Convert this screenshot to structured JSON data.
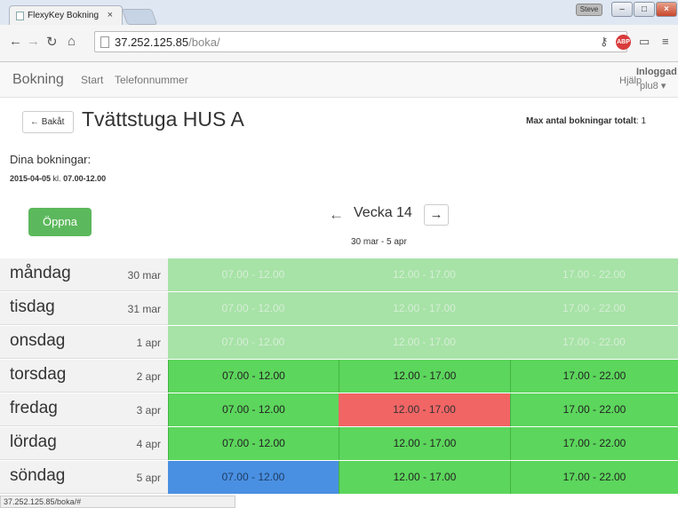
{
  "browser": {
    "tab_title": "FlexyKey Bokning",
    "tab_close": "×",
    "user_badge": "Steve",
    "url_host": "37.252.125.85",
    "url_path": "/boka/",
    "status_url": "37.252.125.85/boka/#"
  },
  "nav": {
    "brand": "Bokning",
    "links": [
      "Start",
      "Telefonnummer"
    ],
    "help": "Hjälp",
    "logged_in_label": "Inloggad:",
    "user": "plu8 ▾"
  },
  "header": {
    "back_label": "← Bakåt",
    "room_title": "Tvättstuga HUS A",
    "max_label": "Max antal bokningar totalt",
    "max_value": ": 1"
  },
  "my_bookings": {
    "label": "Dina bokningar:",
    "date": "2015-04-05",
    "kl": " kl. ",
    "time": "07.00-12.00"
  },
  "open_label": "Öppna",
  "week": {
    "prev": "←",
    "label": "Vecka 14",
    "next": "→",
    "range": "30 mar - 5 apr"
  },
  "schedule": [
    {
      "day": "måndag",
      "date": "30 mar",
      "slots": [
        {
          "time": "07.00 - 12.00",
          "state": "past"
        },
        {
          "time": "12.00 - 17.00",
          "state": "past"
        },
        {
          "time": "17.00 - 22.00",
          "state": "past"
        }
      ]
    },
    {
      "day": "tisdag",
      "date": "31 mar",
      "slots": [
        {
          "time": "07.00 - 12.00",
          "state": "past"
        },
        {
          "time": "12.00 - 17.00",
          "state": "past"
        },
        {
          "time": "17.00 - 22.00",
          "state": "past"
        }
      ]
    },
    {
      "day": "onsdag",
      "date": "1 apr",
      "slots": [
        {
          "time": "07.00 - 12.00",
          "state": "past"
        },
        {
          "time": "12.00 - 17.00",
          "state": "past"
        },
        {
          "time": "17.00 - 22.00",
          "state": "past"
        }
      ]
    },
    {
      "day": "torsdag",
      "date": "2 apr",
      "slots": [
        {
          "time": "07.00 - 12.00",
          "state": "avail"
        },
        {
          "time": "12.00 - 17.00",
          "state": "avail"
        },
        {
          "time": "17.00 - 22.00",
          "state": "avail"
        }
      ]
    },
    {
      "day": "fredag",
      "date": "3 apr",
      "slots": [
        {
          "time": "07.00 - 12.00",
          "state": "avail"
        },
        {
          "time": "12.00 - 17.00",
          "state": "taken"
        },
        {
          "time": "17.00 - 22.00",
          "state": "avail"
        }
      ]
    },
    {
      "day": "lördag",
      "date": "4 apr",
      "slots": [
        {
          "time": "07.00 - 12.00",
          "state": "avail"
        },
        {
          "time": "12.00 - 17.00",
          "state": "avail"
        },
        {
          "time": "17.00 - 22.00",
          "state": "avail"
        }
      ]
    },
    {
      "day": "söndag",
      "date": "5 apr",
      "slots": [
        {
          "time": "07.00 - 12.00",
          "state": "mine"
        },
        {
          "time": "12.00 - 17.00",
          "state": "avail"
        },
        {
          "time": "17.00 - 22.00",
          "state": "avail"
        }
      ]
    }
  ],
  "colors": {
    "past": "#a7e2a7",
    "avail": "#5cd65c",
    "taken": "#f26565",
    "mine": "#4a90e2",
    "open_button": "#5cb85c"
  }
}
